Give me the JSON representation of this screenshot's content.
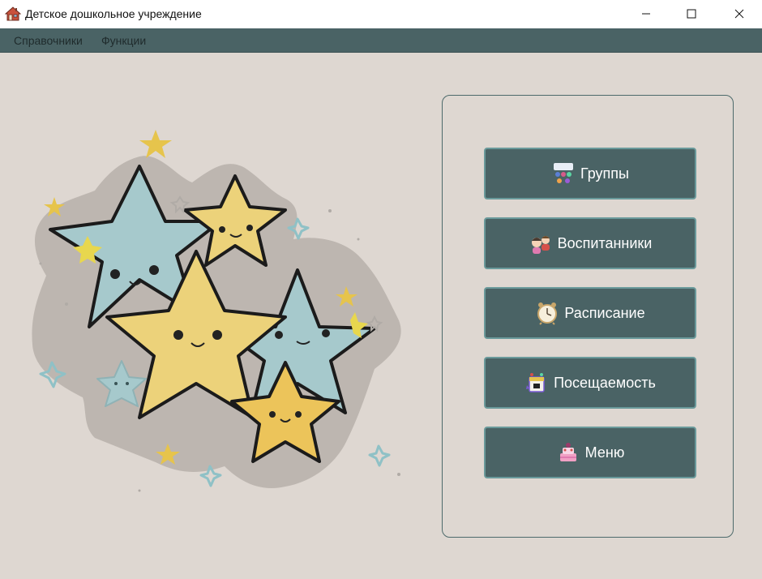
{
  "window": {
    "title": "Детское дошкольное учреждение",
    "icon": "house-icon"
  },
  "menubar": {
    "items": [
      {
        "label": "Справочники"
      },
      {
        "label": "Функции"
      }
    ]
  },
  "panel": {
    "buttons": [
      {
        "label": "Группы",
        "icon": "groups-icon"
      },
      {
        "label": "Воспитанники",
        "icon": "children-icon"
      },
      {
        "label": "Расписание",
        "icon": "alarm-clock-icon"
      },
      {
        "label": "Посещаемость",
        "icon": "calendar-icon"
      },
      {
        "label": "Меню",
        "icon": "cake-icon"
      }
    ]
  },
  "colors": {
    "menubar_bg": "#4a6365",
    "main_bg": "#ded7d1",
    "button_bg": "#4a6365",
    "button_border": "#6a9a9b",
    "panel_border": "#4d6a6b",
    "star_yellow": "#ecd27a",
    "star_teal": "#a9cdd0"
  }
}
